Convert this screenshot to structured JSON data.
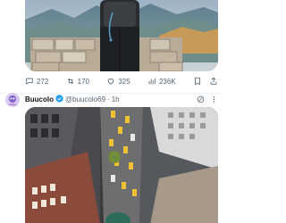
{
  "post1": {
    "actions": {
      "reply_count": "272",
      "repost_count": "170",
      "like_count": "325",
      "view_count": "236K"
    },
    "icons": {
      "reply": "reply-icon",
      "repost": "repost-icon",
      "like": "heart-icon",
      "views": "views-icon",
      "bookmark": "bookmark-icon",
      "share": "share-icon"
    }
  },
  "post2": {
    "display_name": "Buucolo",
    "handle": "@buucolo69",
    "separator": "·",
    "time": "1h",
    "verified_color": "#1d9bf0",
    "icons": {
      "verified": "verified-badge-icon",
      "grok": "grok-icon",
      "more": "more-icon"
    }
  },
  "colors": {
    "text_primary": "#0f1419",
    "text_secondary": "#536471",
    "accent": "#1d9bf0"
  }
}
